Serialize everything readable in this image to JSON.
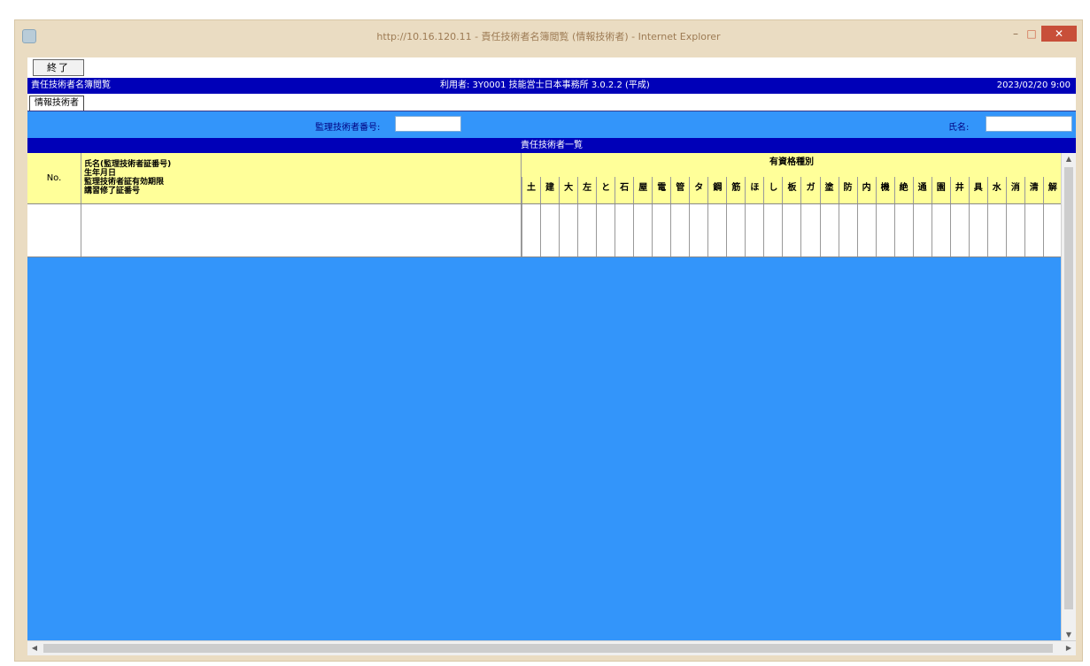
{
  "window": {
    "title": "http://10.16.120.11 - 責任技術者名簿閲覧 (情報技術者) - Internet Explorer",
    "close_label": "✕",
    "minimize_label": "–",
    "maximize_label": "□"
  },
  "toolbar": {
    "end_label": "終了"
  },
  "header": {
    "system_name": "責任技術者名簿閲覧",
    "center_info": "利用者: 3Y0001  技能営士日本事務所  3.0.2.2 (平成)",
    "right_info": "2023/02/20 9:00"
  },
  "tabs": [
    {
      "label": "情報技術者"
    }
  ],
  "filters": {
    "id_label": "監理技術者番号:",
    "id_value": "",
    "name_label": "氏名:",
    "name_value": ""
  },
  "list": {
    "title": "責任技術者一覧",
    "columns": {
      "no": "No.",
      "name_lines": [
        "氏名(監理技術者証番号)",
        "生年月日",
        "監理技術者証有効期限",
        "講習修了証番号"
      ],
      "qualification_title": "有資格種別",
      "qualification_codes": [
        "土",
        "建",
        "大",
        "左",
        "と",
        "石",
        "屋",
        "電",
        "管",
        "タ",
        "鋼",
        "筋",
        "ほ",
        "し",
        "板",
        "ガ",
        "塗",
        "防",
        "内",
        "機",
        "絶",
        "通",
        "園",
        "井",
        "具",
        "水",
        "消",
        "清",
        "解"
      ]
    },
    "rows": [
      {
        "no": "",
        "name": ""
      }
    ]
  },
  "colors": {
    "header_bar": "#0000b8",
    "filter_bar": "#3395fa",
    "column_header": "#ffff99",
    "title_bar": "#eadcc2"
  }
}
